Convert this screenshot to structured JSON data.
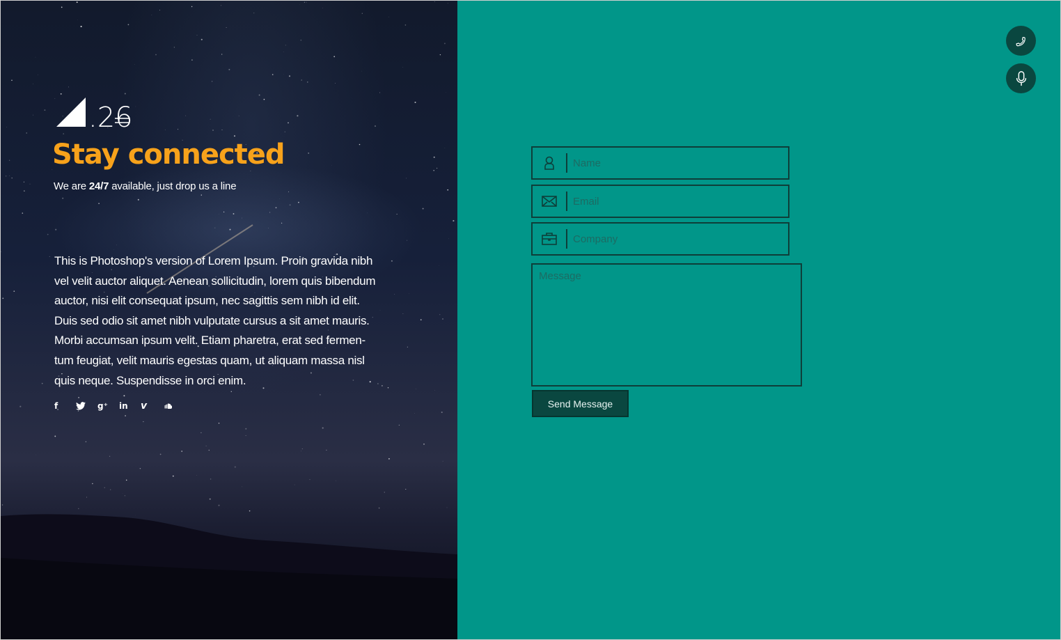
{
  "colors": {
    "accent_orange": "#f7a21b",
    "teal_background": "#019689",
    "dark_teal": "#0a4740"
  },
  "hero": {
    "logo_text": ".26",
    "title": "Stay connected",
    "subtitle_prefix": "We are ",
    "subtitle_bold": "24/7",
    "subtitle_suffix": " available, just drop us a line",
    "paragraph": "This is Photoshop's version  of Lorem Ipsum. Proin gravida nibh vel velit auctor aliquet. Aenean sollicitudin, lorem quis bibendum auctor, nisi elit consequat ipsum, nec sagittis sem nibh id elit. Duis sed odio sit amet nibh vulputate cursus a sit amet mauris. Morbi accumsan ipsum velit. Etiam pharetra, erat sed fermen-tum feugiat, velit mauris egestas quam, ut aliquam massa nisl quis neque. Suspendisse in orci enim.",
    "social": [
      {
        "icon": "facebook-icon",
        "glyph": "f"
      },
      {
        "icon": "twitter-icon",
        "glyph": ""
      },
      {
        "icon": "google-plus-icon",
        "glyph": "g⁺"
      },
      {
        "icon": "linkedin-icon",
        "glyph": "in"
      },
      {
        "icon": "vimeo-icon",
        "glyph": "v"
      },
      {
        "icon": "soundcloud-icon",
        "glyph": ""
      }
    ]
  },
  "form": {
    "name_placeholder": "Name",
    "email_placeholder": "Email",
    "company_placeholder": "Company",
    "message_placeholder": "Message",
    "send_label": "Send Message",
    "name_icon": "user-icon",
    "email_icon": "envelope-icon",
    "company_icon": "briefcase-icon"
  },
  "quick_actions": [
    {
      "icon": "phone-icon"
    },
    {
      "icon": "microphone-icon"
    }
  ]
}
